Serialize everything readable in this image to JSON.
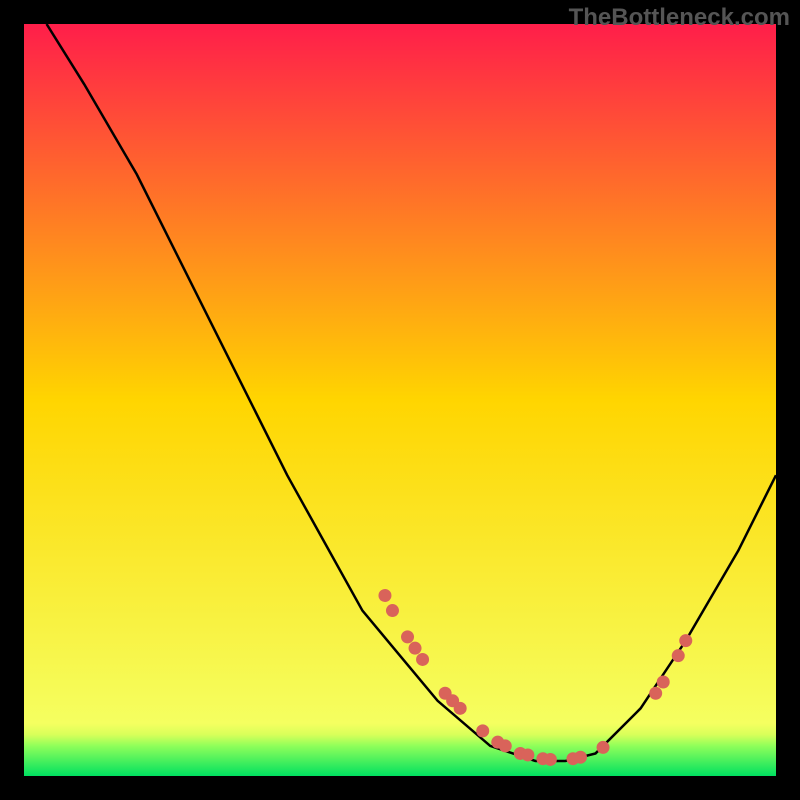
{
  "watermark": "TheBottleneck.com",
  "chart_data": {
    "type": "line",
    "title": "",
    "xlabel": "",
    "ylabel": "",
    "xlim": [
      0,
      100
    ],
    "ylim": [
      0,
      100
    ],
    "gradient_stops": [
      {
        "offset": 0,
        "color": "#ff1e4a"
      },
      {
        "offset": 50,
        "color": "#ffd500"
      },
      {
        "offset": 93,
        "color": "#f5ff60"
      },
      {
        "offset": 94.5,
        "color": "#d8ff5a"
      },
      {
        "offset": 96,
        "color": "#8fff5a"
      },
      {
        "offset": 100,
        "color": "#00e060"
      }
    ],
    "curve": [
      {
        "x": 3,
        "y": 100
      },
      {
        "x": 8,
        "y": 92
      },
      {
        "x": 15,
        "y": 80
      },
      {
        "x": 25,
        "y": 60
      },
      {
        "x": 35,
        "y": 40
      },
      {
        "x": 45,
        "y": 22
      },
      {
        "x": 55,
        "y": 10
      },
      {
        "x": 62,
        "y": 4
      },
      {
        "x": 68,
        "y": 2
      },
      {
        "x": 72,
        "y": 2
      },
      {
        "x": 76,
        "y": 3
      },
      {
        "x": 82,
        "y": 9
      },
      {
        "x": 88,
        "y": 18
      },
      {
        "x": 95,
        "y": 30
      },
      {
        "x": 100,
        "y": 40
      }
    ],
    "markers": [
      {
        "x": 48,
        "y": 24
      },
      {
        "x": 49,
        "y": 22
      },
      {
        "x": 51,
        "y": 18.5
      },
      {
        "x": 52,
        "y": 17
      },
      {
        "x": 53,
        "y": 15.5
      },
      {
        "x": 56,
        "y": 11
      },
      {
        "x": 57,
        "y": 10
      },
      {
        "x": 58,
        "y": 9
      },
      {
        "x": 61,
        "y": 6
      },
      {
        "x": 63,
        "y": 4.5
      },
      {
        "x": 64,
        "y": 4
      },
      {
        "x": 66,
        "y": 3
      },
      {
        "x": 67,
        "y": 2.8
      },
      {
        "x": 69,
        "y": 2.3
      },
      {
        "x": 70,
        "y": 2.2
      },
      {
        "x": 73,
        "y": 2.3
      },
      {
        "x": 74,
        "y": 2.5
      },
      {
        "x": 77,
        "y": 3.8
      },
      {
        "x": 84,
        "y": 11
      },
      {
        "x": 85,
        "y": 12.5
      },
      {
        "x": 87,
        "y": 16
      },
      {
        "x": 88,
        "y": 18
      }
    ],
    "marker_color": "#d9635a"
  }
}
